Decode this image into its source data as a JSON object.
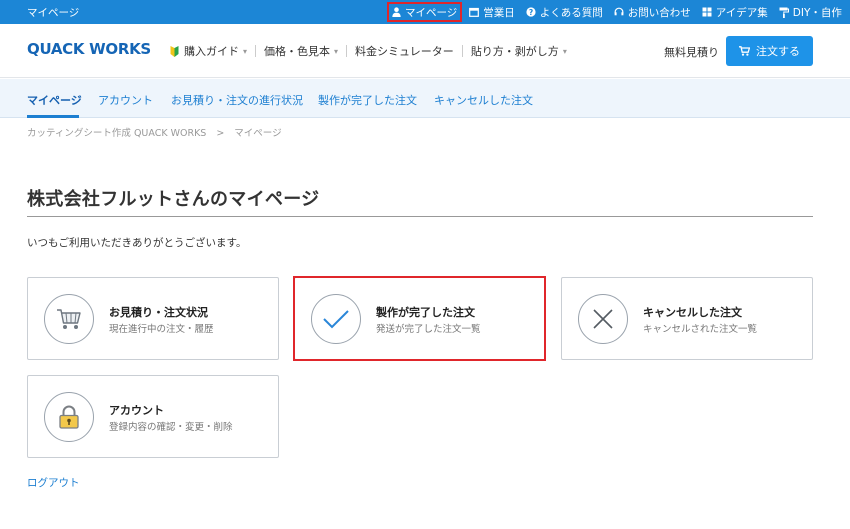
{
  "topbar": {
    "site_label": "マイページ",
    "links": [
      {
        "icon": "person-icon",
        "label": "マイページ"
      },
      {
        "icon": "calendar-icon",
        "label": "営業日"
      },
      {
        "icon": "question-icon",
        "label": "よくある質問"
      },
      {
        "icon": "headset-icon",
        "label": "お問い合わせ"
      },
      {
        "icon": "grid-icon",
        "label": "アイデア集"
      },
      {
        "icon": "paint-roller-icon",
        "label": "DIY・自作"
      }
    ]
  },
  "header": {
    "logo": "QUACK WORKS",
    "nav": [
      "購入ガイド",
      "価格・色見本",
      "料金シミュレーター",
      "貼り方・剥がし方"
    ],
    "estimate_label": "無料見積り",
    "order_label": "注文する"
  },
  "subnav": {
    "tabs": [
      "マイページ",
      "アカウント",
      "お見積り・注文の進行状況",
      "製作が完了した注文",
      "キャンセルした注文"
    ]
  },
  "breadcrumb": {
    "items": [
      "カッティングシート作成 QUACK WORKS",
      "マイページ"
    ],
    "separator": ">"
  },
  "page": {
    "title": "株式会社フルットさんのマイページ",
    "greeting": "いつもご利用いただきありがとうございます。"
  },
  "cards": [
    {
      "icon": "cart-icon",
      "title": "お見積り・注文状況",
      "subtitle": "現在進行中の注文・履歴"
    },
    {
      "icon": "check-icon",
      "title": "製作が完了した注文",
      "subtitle": "発送が完了した注文一覧"
    },
    {
      "icon": "x-icon",
      "title": "キャンセルした注文",
      "subtitle": "キャンセルされた注文一覧"
    },
    {
      "icon": "lock-icon",
      "title": "アカウント",
      "subtitle": "登録内容の確認・変更・削除"
    }
  ],
  "logout_label": "ログアウト",
  "colors": {
    "brand_blue": "#1c86d6",
    "link_blue": "#1d7fd1",
    "highlight_red": "#e0262b",
    "subnav_bg": "#eef5fc"
  }
}
